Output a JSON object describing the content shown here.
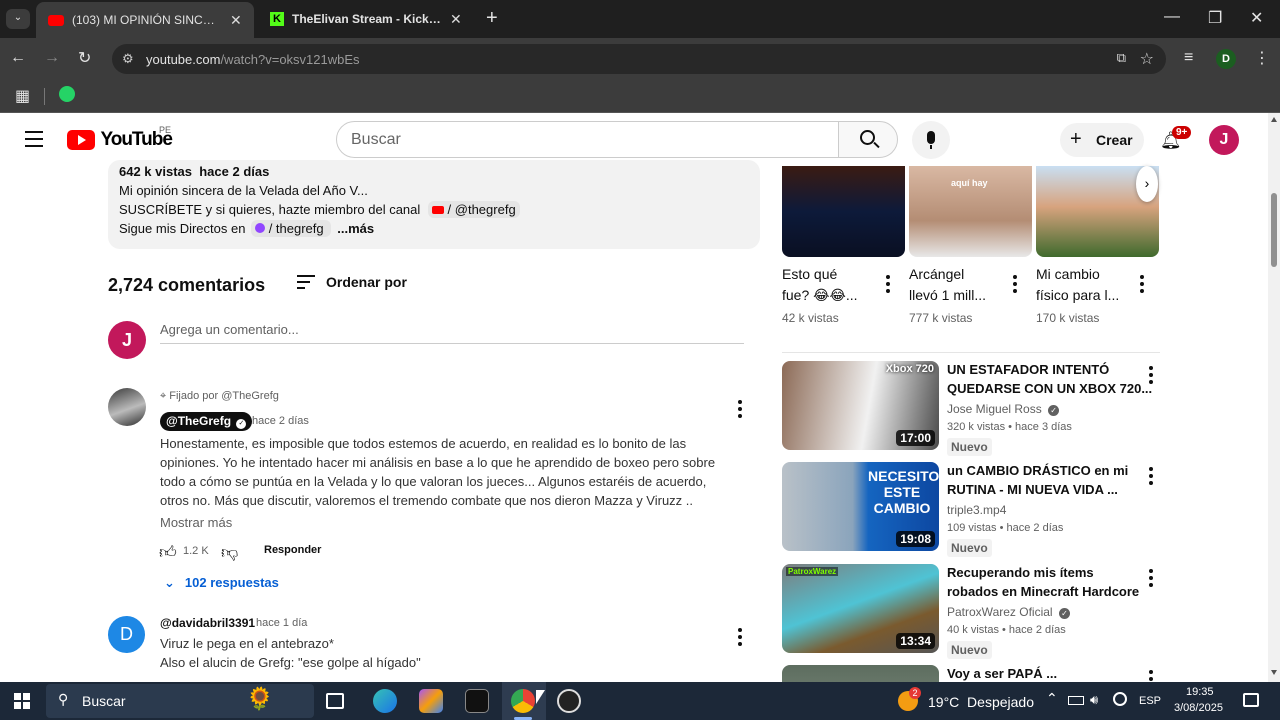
{
  "browser": {
    "tabs": [
      {
        "title": "(103) MI OPINIÓN SINCERA DE",
        "active": true
      },
      {
        "title": "TheElivan Stream - Kick Dashbo",
        "active": false
      }
    ],
    "url_host": "youtube.com",
    "url_path": "/watch?v=oksv121wbEs",
    "profile_letter": "D"
  },
  "yt": {
    "logo_text": "YouTube",
    "region": "PE",
    "search_placeholder": "Buscar",
    "create_label": "Crear",
    "notif_count": "9+",
    "avatar_letter": "J"
  },
  "description": {
    "stats": "642 k vistas  hace 2 días",
    "line1": "Mi opinión sincera de la Velada del Año V...",
    "line2a": "SUSCRÍBETE y si quieres, hazte miembro del canal",
    "line2b": "/ @thegrefg",
    "line3a": "Sigue mis Directos en",
    "line3b": "/ thegrefg",
    "more": "...más"
  },
  "comments": {
    "count": "2,724 comentarios",
    "sort_label": "Ordenar por",
    "add_placeholder": "Agrega un comentario...",
    "pinned": {
      "pinned_label": "Fijado por @TheGrefg",
      "author": "@TheGrefg",
      "time": "hace 2 días",
      "lines": [
        "Honestamente, es imposible que todos estemos de acuerdo, en realidad es lo bonito de las",
        "opiniones. Yo he intentado hacer mi análisis en base a lo que he aprendido de boxeo pero sobre",
        "todo a cómo se puntúa en la Velada y lo que valoran los jueces... Algunos estaréis de acuerdo,",
        "otros no. Más que discutir, valoremos el tremendo combate que nos dieron Mazza y Viruzz .."
      ],
      "show_more": "Mostrar más",
      "likes": "1.2 K",
      "reply": "Responder",
      "replies": "102 respuestas"
    },
    "second": {
      "avatar_letter": "D",
      "author": "@davidabril3391",
      "time": "hace 1 día",
      "lines": [
        "Viruz le pega en el antebrazo*",
        "Also el alucin de Grefg: \"ese golpe al hígado\""
      ]
    }
  },
  "shorts": [
    {
      "title1": "Esto qué",
      "title2": "fue? 😂😂...",
      "views": "42 k vistas"
    },
    {
      "title1": "Arcángel",
      "title2": "llevó 1 mill...",
      "views": "777 k vistas",
      "overlay": "aquí hay"
    },
    {
      "title1": "Mi cambio",
      "title2": "físico para l...",
      "views": "170 k vistas"
    }
  ],
  "videos": [
    {
      "title1": "UN ESTAFADOR INTENTÓ",
      "title2": "QUEDARSE CON UN XBOX 720...",
      "channel": "Jose Miguel Ross",
      "verified": true,
      "meta": "320 k vistas • hace 3 días",
      "badge": "Nuevo",
      "duration": "17:00",
      "thumb_text": "Xbox 720"
    },
    {
      "title1": "un CAMBIO DRÁSTICO en mi",
      "title2": "RUTINA - MI NUEVA VIDA ...",
      "channel": "triple3.mp4",
      "verified": false,
      "meta": "109 vistas • hace 2 días",
      "badge": "Nuevo",
      "duration": "19:08",
      "thumb_text": "NECESITO ESTE CAMBIO"
    },
    {
      "title1": "Recuperando mis ítems",
      "title2": "robados en Minecraft Hardcore",
      "channel": "PatroxWarez Oficial",
      "verified": true,
      "meta": "40 k vistas • hace 2 días",
      "badge": "Nuevo",
      "duration": "13:34",
      "thumb_text": "PatroxWarez"
    },
    {
      "title1": "Voy a ser PAPÁ ...",
      "title2": "",
      "channel": "",
      "verified": false,
      "meta": "",
      "badge": "",
      "duration": "",
      "thumb_text": ""
    }
  ],
  "taskbar": {
    "search_label": "Buscar",
    "weather": "19°C  Despejado",
    "weather_badge": "2",
    "lang": "ESP",
    "time": "19:35",
    "date": "3/08/2025"
  }
}
